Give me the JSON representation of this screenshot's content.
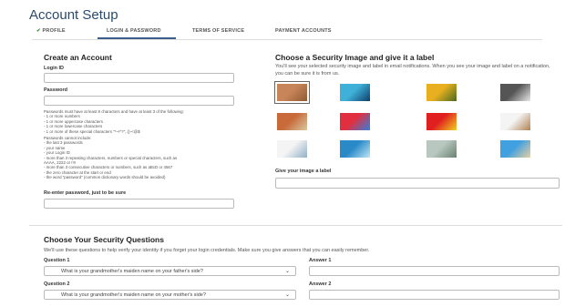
{
  "page": {
    "title": "Account Setup"
  },
  "tabs": [
    {
      "label": "PROFILE",
      "check": "✔",
      "completed": true
    },
    {
      "label": "LOGIN & PASSWORD",
      "active": true
    },
    {
      "label": "TERMS OF SERVICE"
    },
    {
      "label": "PAYMENT ACCOUNTS"
    }
  ],
  "colors": {
    "accent": "#3a5f8a",
    "title": "#2a4a6e",
    "check": "#3a8a3a"
  },
  "create_account": {
    "title": "Create an Account",
    "login_id_label": "Login ID",
    "password_label": "Password",
    "rules_intro": "Passwords must have at least 8 characters and have at least 3 of the following:",
    "rules": [
      "- 1 or more numbers",
      "- 1 or more uppercase characters",
      "- 1 or more lowercase characters",
      "- 1 or more of these special characters \"*~!^?\",.()-<@$"
    ],
    "cannot_intro": "Passwords cannot include:",
    "cannot": [
      "- the last 3 passwords",
      "- your name",
      "- your Login ID",
      "- more than 3 repeating characters, numbers or special characters, such as",
      "  AAAA, 2222 or !!!!",
      "- more than 3 consecutive characters or numbers, such as aBcD or 4567",
      "- the zero character at the start or end",
      "- the word \"password\" (common dictionary words should be avoided)"
    ],
    "reenter_label": "Re-enter password, just to be sure"
  },
  "security_image": {
    "title": "Choose a Security Image and give it a label",
    "description": "You'll see your selected security image and label in email notifications. When you see your image and label on a notification, you can be sure it is from us.",
    "images": [
      {
        "name": "tree-image",
        "selected": true,
        "colors": [
          "#c9855a",
          "#8f5a32"
        ]
      },
      {
        "name": "eye-image",
        "selected": false,
        "colors": [
          "#3fb0d8",
          "#0b3e6a"
        ]
      },
      {
        "name": "sunflowers-image",
        "selected": false,
        "colors": [
          "#e8b020",
          "#4a6a20"
        ]
      },
      {
        "name": "hands-image",
        "selected": false,
        "colors": [
          "#555555",
          "#e8e8e8"
        ]
      },
      {
        "name": "animal-image",
        "selected": false,
        "colors": [
          "#c86a3a",
          "#d8c8a0"
        ]
      },
      {
        "name": "balloons-image",
        "selected": false,
        "colors": [
          "#e03040",
          "#3080e0"
        ]
      },
      {
        "name": "flag-image",
        "selected": false,
        "colors": [
          "#e02020",
          "#f0d020"
        ]
      },
      {
        "name": "dog-image",
        "selected": false,
        "colors": [
          "#f4f4f4",
          "#b08050"
        ]
      },
      {
        "name": "glass-image",
        "selected": false,
        "colors": [
          "#f4f4f4",
          "#90b0c8"
        ]
      },
      {
        "name": "water-image",
        "selected": false,
        "colors": [
          "#2a8ac8",
          "#bfe6f5"
        ]
      },
      {
        "name": "leaves-image",
        "selected": false,
        "colors": [
          "#b8c8c0",
          "#6a8070"
        ]
      },
      {
        "name": "beach-image",
        "selected": false,
        "colors": [
          "#40a0e0",
          "#e8d0a0"
        ]
      }
    ],
    "label_field_label": "Give your image a label"
  },
  "security_questions": {
    "title": "Choose Your Security Questions",
    "description": "We'll use these questions to help verify your identity if you forget your login credentials. Make sure you give answers that you can easily remember.",
    "questions": [
      {
        "label": "Question 1",
        "value": "What is your grandmother's maiden name on your father's side?",
        "answer_label": "Answer 1"
      },
      {
        "label": "Question 2",
        "value": "What is your grandmother's maiden name on your mother's side?",
        "answer_label": "Answer 2"
      }
    ]
  }
}
